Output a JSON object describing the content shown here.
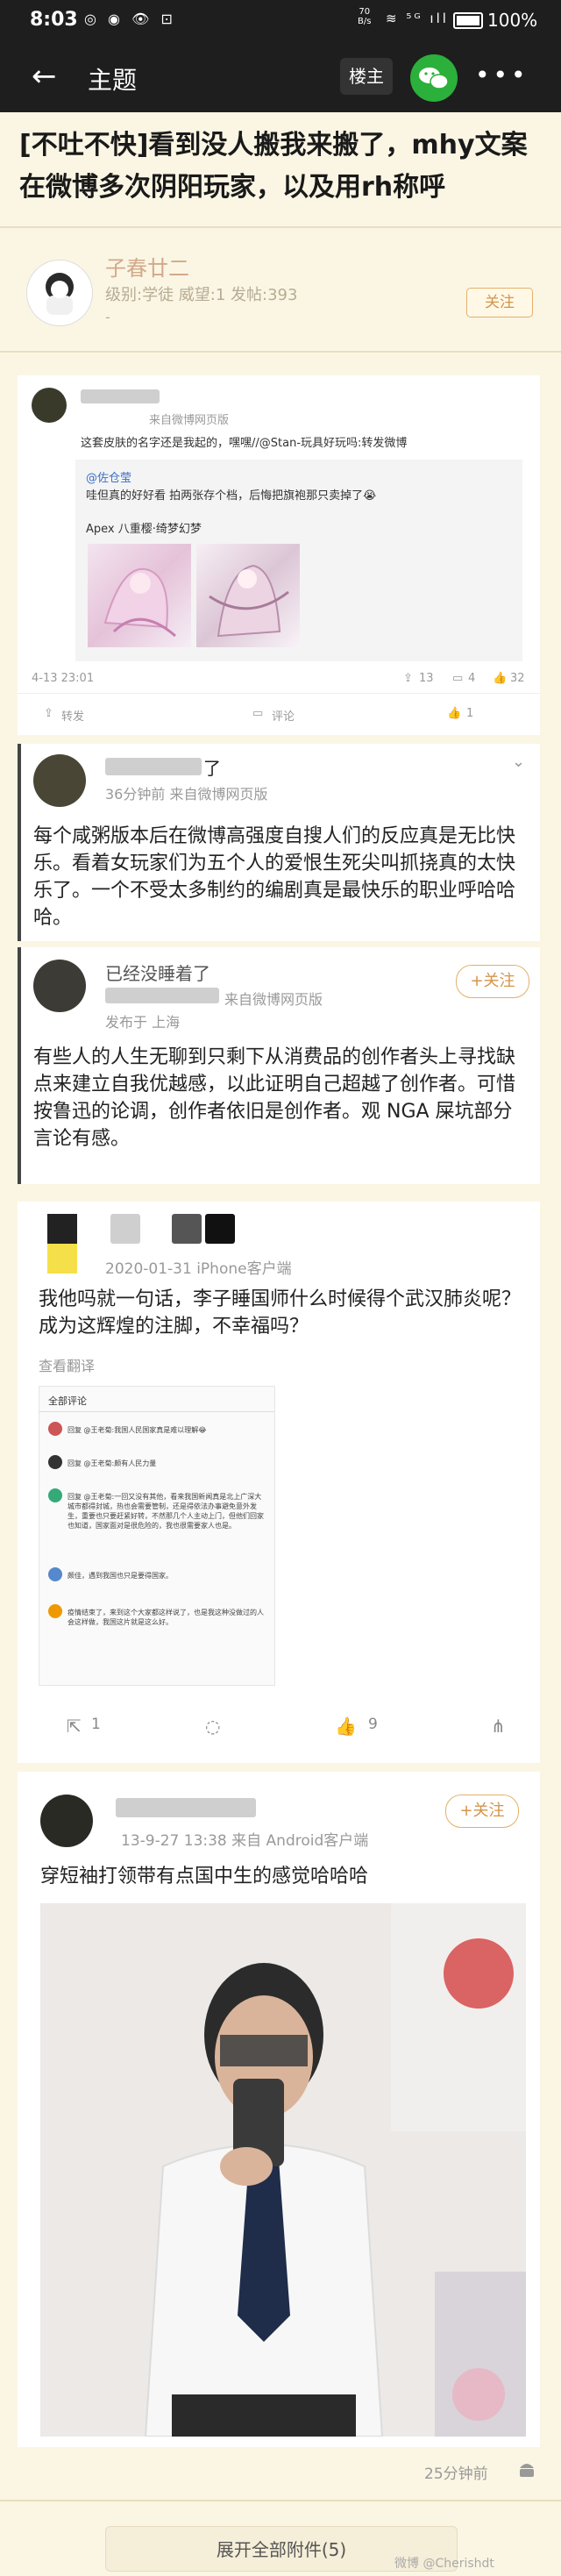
{
  "status_bar": {
    "time": "8:03",
    "left_icons": "◎ ◉ 👁 ⊡",
    "net_speed": "70\nB/s",
    "signal_icons": "≋ ⁵ᴳ ıll",
    "battery_pct": "100%"
  },
  "nav": {
    "back_icon": "←",
    "title": "主题",
    "louzhu_label": "楼主",
    "wechat_icon": "wechat-icon",
    "more_icon": "•••"
  },
  "post": {
    "title": "[不吐不快]看到没人搬我来搬了，mhy文案在微博多次阴阳玩家，以及用rh称呼"
  },
  "author": {
    "name": "子春廿二",
    "info": "级别:学徒 威望:1 发帖:393",
    "extra": "-",
    "follow_label": "关注"
  },
  "card1": {
    "source": "来自微博网页版",
    "text": "这套皮肤的名字还是我起的，嘿嘿//@Stan-玩具好玩吗:转发微博",
    "mention": "@佐仓莹",
    "quote": "哇但真的好好看 拍两张存个档，后悔把旗袍那只卖掉了😭",
    "caption": "Apex 八重樱·绮梦幻梦",
    "date": "4-13 23:01",
    "stats": {
      "share": "13",
      "comment": "4",
      "like": "32"
    },
    "actions": {
      "repost": "转发",
      "comment": "评论",
      "like": "1"
    }
  },
  "card2": {
    "name_tail": "了",
    "meta": "36分钟前  来自微博网页版",
    "text": "每个咸粥版本后在微博高强度自搜人们的反应真是无比快乐。看着女玩家们为五个人的爱恨生死尖叫抓挠真的太快乐了。一个不受太多制约的编剧真是最快乐的职业呼哈哈哈。"
  },
  "card3": {
    "name": "已经没睡着了",
    "meta": "来自微博网页版",
    "location": "发布于 上海",
    "follow_label": "+关注",
    "text": "有些人的人生无聊到只剩下从消费品的创作者头上寻找缺点来建立自我优越感，以此证明自己超越了创作者。可惜按鲁迅的论调，创作者依旧是创作者。观 NGA 屎坑部分言论有感。"
  },
  "card4": {
    "meta": "2020-01-31  iPhone客户端",
    "text": "我他吗就一句话，李子睡国师什么时候得个武汉肺炎呢？成为这辉煌的注脚，不幸福吗？",
    "translate": "查看翻译",
    "shot_header": "全部评论",
    "shot_rows": [
      "回复 @王老菊:我国人民国家真是难以理解😂",
      "回复 @王老菊:颇有人民力量",
      "回复 @王老菊:一回又没有其他，看来我国新闻真是北上广深大城市都得封城，热也会需要管制，还是得依法办事避免意外发生，重要也只要赶紧好转，不然那几个人主动上门，但他们回家也知道，国家面对是很危险的，我也很需要家人也是。",
      "颇佳，遇到我国也只是要得国家。",
      "疫情结束了，来到这个大家都这样说了，也是我这种没做过的人会这样做，我国这片就是这么好。"
    ],
    "stats": {
      "share": "1",
      "like": "9"
    }
  },
  "card5": {
    "meta": "13-9-27 13:38  来自 Android客户端",
    "follow_label": "+关注",
    "text": "穿短袖打领带有点国中生的感觉哈哈哈"
  },
  "footer": {
    "time": "25分钟前",
    "expand": "展开全部附件(5)",
    "watermark": "微博 @Cherishdt"
  },
  "colors": {
    "bg": "#fbf6e4",
    "bar": "#1e1e1e",
    "accent": "#d4944a",
    "wechat": "#2bb03b"
  }
}
